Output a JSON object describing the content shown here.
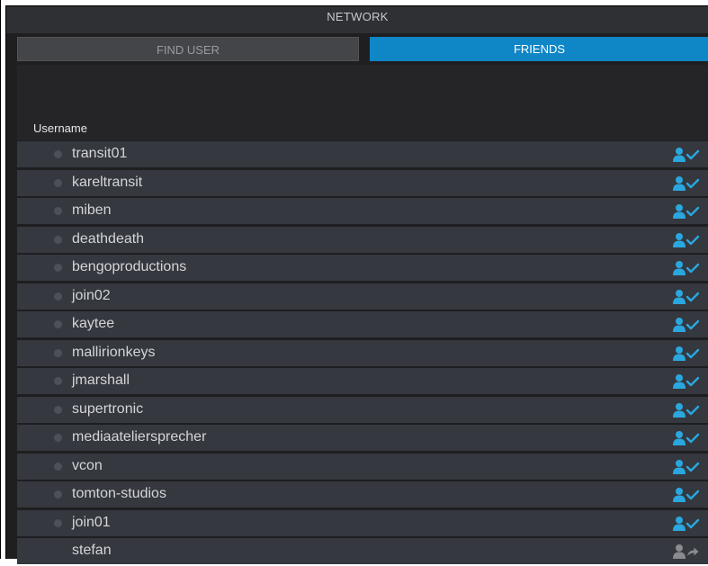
{
  "window": {
    "title": "NETWORK"
  },
  "tabs": [
    {
      "label": "FIND USER",
      "active": false
    },
    {
      "label": "FRIENDS",
      "active": true
    }
  ],
  "table": {
    "column_header": "Username",
    "rows": [
      {
        "username": "transit01",
        "online_dot": true,
        "status_icon": "friend-confirmed-icon"
      },
      {
        "username": "kareltransit",
        "online_dot": true,
        "status_icon": "friend-confirmed-icon"
      },
      {
        "username": "miben",
        "online_dot": true,
        "status_icon": "friend-confirmed-icon"
      },
      {
        "username": "deathdeath",
        "online_dot": true,
        "status_icon": "friend-confirmed-icon"
      },
      {
        "username": "bengoproductions",
        "online_dot": true,
        "status_icon": "friend-confirmed-icon"
      },
      {
        "username": "join02",
        "online_dot": true,
        "status_icon": "friend-confirmed-icon"
      },
      {
        "username": "kaytee",
        "online_dot": true,
        "status_icon": "friend-confirmed-icon"
      },
      {
        "username": "mallirionkeys",
        "online_dot": true,
        "status_icon": "friend-confirmed-icon"
      },
      {
        "username": "jmarshall",
        "online_dot": true,
        "status_icon": "friend-confirmed-icon"
      },
      {
        "username": "supertronic",
        "online_dot": true,
        "status_icon": "friend-confirmed-icon"
      },
      {
        "username": "mediaateliersprecher",
        "online_dot": true,
        "status_icon": "friend-confirmed-icon"
      },
      {
        "username": "vcon",
        "online_dot": true,
        "status_icon": "friend-confirmed-icon"
      },
      {
        "username": "tomton-studios",
        "online_dot": true,
        "status_icon": "friend-confirmed-icon"
      },
      {
        "username": "join01",
        "online_dot": true,
        "status_icon": "friend-confirmed-icon"
      },
      {
        "username": "stefan",
        "online_dot": false,
        "status_icon": "friend-request-sent-icon"
      }
    ]
  },
  "colors": {
    "accent": "#0f86c6",
    "icon_confirmed": "#2aa7df",
    "icon_pending": "#8a8b90"
  }
}
